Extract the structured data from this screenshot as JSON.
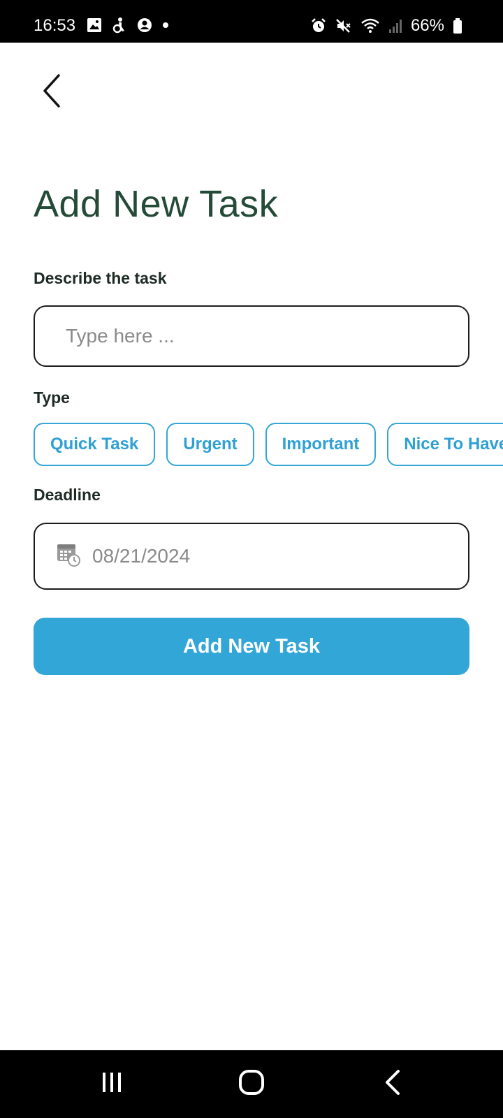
{
  "status_bar": {
    "time": "16:53",
    "battery_percent": "66%",
    "left_icons": [
      "gallery-icon",
      "accessibility-icon",
      "account-icon",
      "dot-icon"
    ],
    "right_icons": [
      "alarm-icon",
      "mute-icon",
      "wifi-icon",
      "signal-icon",
      "battery-icon"
    ]
  },
  "header": {
    "back_icon": "chevron-left-icon"
  },
  "page": {
    "title": "Add New Task"
  },
  "form": {
    "description_label": "Describe the task",
    "description_placeholder": "Type here ...",
    "description_value": "",
    "type_label": "Type",
    "type_options": [
      "Quick Task",
      "Urgent",
      "Important",
      "Nice To Have"
    ],
    "deadline_label": "Deadline",
    "deadline_value": "08/21/2024",
    "deadline_icon": "calendar-clock-icon",
    "submit_label": "Add New Task"
  },
  "colors": {
    "accent": "#33a6d8",
    "title": "#244a38",
    "border": "#1c1c1c",
    "placeholder": "#8a8a8a"
  },
  "nav_bar": {
    "icons": [
      "recents-icon",
      "home-icon",
      "back-icon"
    ]
  }
}
